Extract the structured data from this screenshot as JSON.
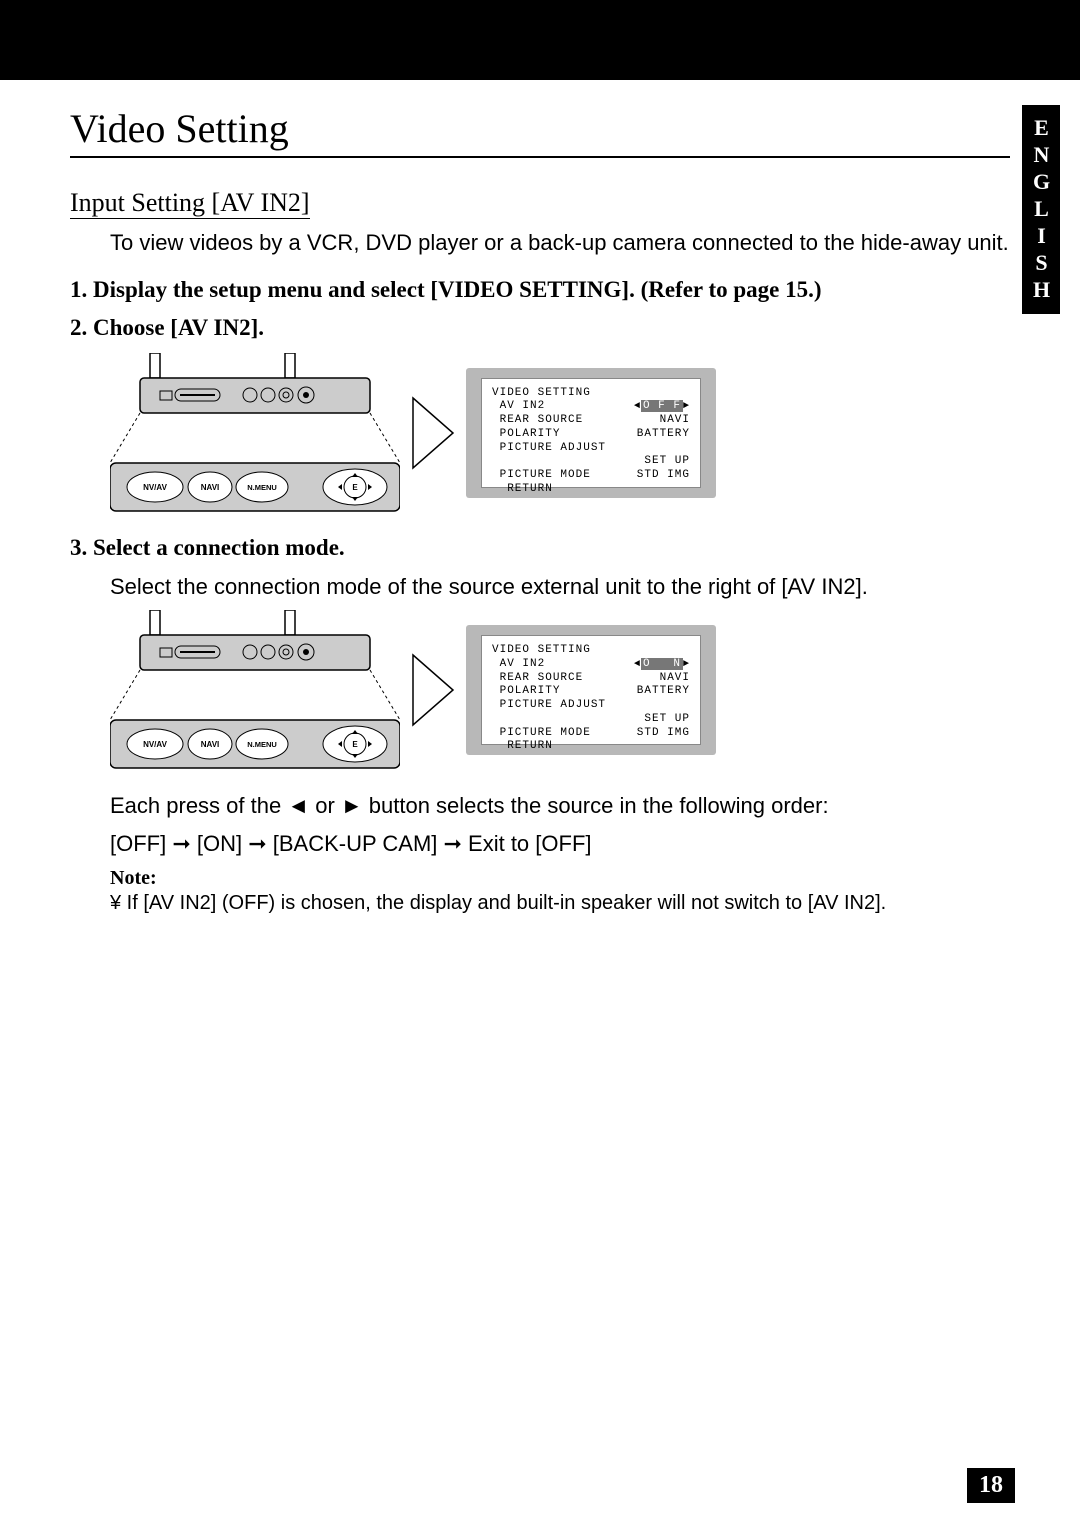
{
  "language_tab": "ENGLISH",
  "page_title": "Video Setting",
  "section_heading": "Input Setting [AV IN2]",
  "intro": "To view videos by a VCR, DVD player or a back-up camera connected to the hide-away unit.",
  "steps": {
    "s1": "1.  Display the setup menu and select [VIDEO SETTING]. (Refer to page 15.)",
    "s2": "2.  Choose [AV IN2].",
    "s3": "3.  Select a connection mode.",
    "s3_sub": "Select the connection mode of the source external unit to the right of [AV IN2]."
  },
  "buttons": {
    "nv_av": "NV/AV",
    "navi": "NAVI",
    "nmenu": "N.MENU",
    "e": "E"
  },
  "menu1": {
    "title": "VIDEO SETTING",
    "av_label": "AV IN2",
    "av_value": "O F F",
    "rear_label": "REAR SOURCE",
    "rear_value": "NAVI",
    "pol_label": "POLARITY",
    "pol_value": "BATTERY",
    "pic_adjust": "PICTURE ADJUST",
    "setup": "SET UP",
    "picmode_label": "PICTURE MODE",
    "picmode_value": "STD IMG",
    "return": "RETURN"
  },
  "menu2": {
    "title": "VIDEO SETTING",
    "av_label": "AV IN2",
    "av_value": "O   N",
    "rear_label": "REAR SOURCE",
    "rear_value": "NAVI",
    "pol_label": "POLARITY",
    "pol_value": "BATTERY",
    "pic_adjust": "PICTURE ADJUST",
    "setup": "SET UP",
    "picmode_label": "PICTURE MODE",
    "picmode_value": "STD IMG",
    "return": "RETURN"
  },
  "sequence_line1": "Each press of the ◄ or ► button selects the source in the following order:",
  "sequence_line2": "[OFF] ➞ [ON] ➞ [BACK-UP CAM] ➞ Exit to [OFF]",
  "note_label": "Note:",
  "note_text": "¥  If [AV IN2] (OFF) is chosen, the display and built-in speaker will not switch to [AV IN2].",
  "page_number": "18"
}
